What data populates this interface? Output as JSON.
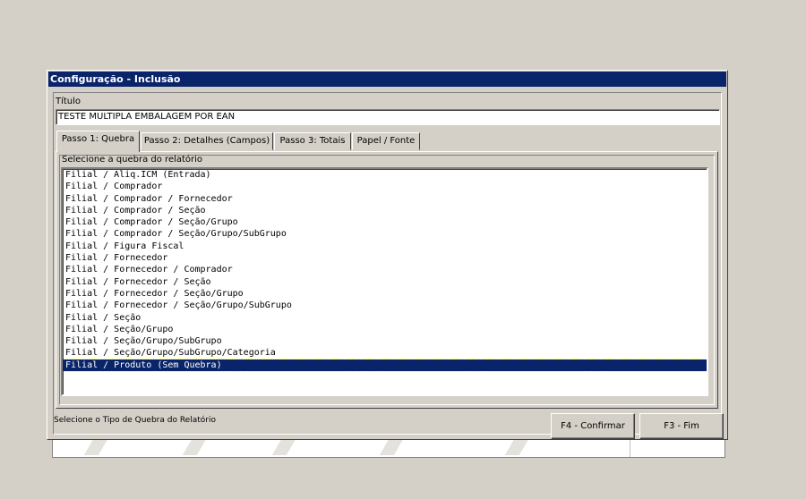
{
  "window": {
    "title": "Configuração - Inclusão"
  },
  "titulo": {
    "label": "Título",
    "value": "TESTE MULTIPLA EMBALAGEM POR EAN"
  },
  "tabs": [
    {
      "label": "Passo 1: Quebra",
      "active": true
    },
    {
      "label": "Passo 2: Detalhes (Campos)",
      "active": false
    },
    {
      "label": "Passo 3: Totais",
      "active": false
    },
    {
      "label": "Papel / Fonte",
      "active": false
    }
  ],
  "quebra": {
    "group_label": "Selecione a quebra do relatório",
    "items": [
      "Filial / Aliq.ICM (Entrada)",
      "Filial / Comprador",
      "Filial / Comprador / Fornecedor",
      "Filial / Comprador / Seção",
      "Filial / Comprador / Seção/Grupo",
      "Filial / Comprador / Seção/Grupo/SubGrupo",
      "Filial / Figura Fiscal",
      "Filial / Fornecedor",
      "Filial / Fornecedor / Comprador",
      "Filial / Fornecedor / Seção",
      "Filial / Fornecedor / Seção/Grupo",
      "Filial / Fornecedor / Seção/Grupo/SubGrupo",
      "Filial / Seção",
      "Filial / Seção/Grupo",
      "Filial / Seção/Grupo/SubGrupo",
      "Filial / Seção/Grupo/SubGrupo/Categoria",
      "Filial / Produto (Sem Quebra)"
    ],
    "selected_index": 16
  },
  "status": {
    "text": "Selecione o Tipo de Quebra do Relatório"
  },
  "buttons": {
    "confirm": "F4 - Confirmar",
    "exit": "F3 - Fim"
  },
  "colors": {
    "titlebar": "#0a246a",
    "face": "#d4d0c8",
    "selection": "#0a246a"
  }
}
